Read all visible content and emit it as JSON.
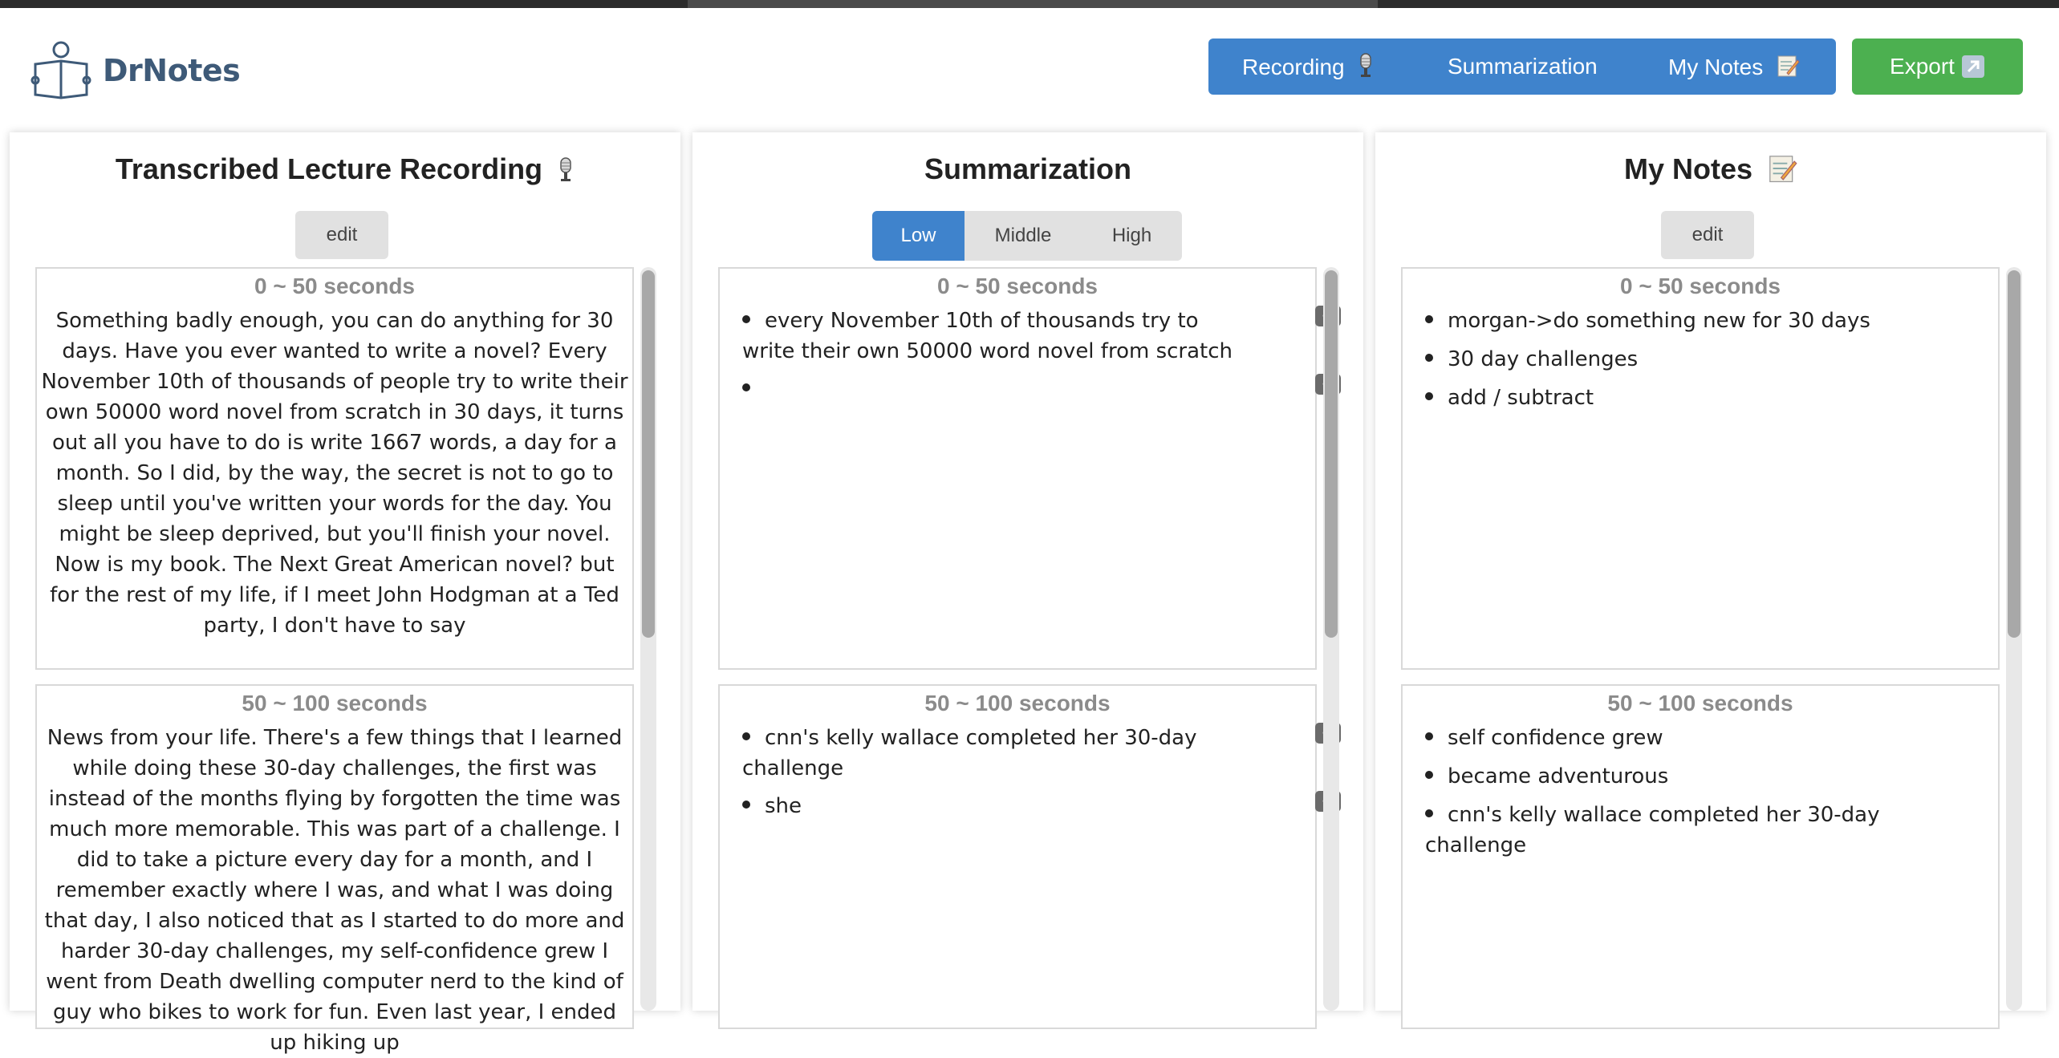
{
  "app": {
    "name": "DrNotes"
  },
  "nav": {
    "recording_label": "Recording",
    "summarization_label": "Summarization",
    "my_notes_label": "My Notes",
    "export_label": "Export"
  },
  "icons": {
    "logo": "reader-book-logo-icon",
    "microphone": "microphone-icon",
    "memo": "memo-icon",
    "export": "export-arrow-icon"
  },
  "colors": {
    "nav_bg": "#3f83cc",
    "export_bg": "#4cb050",
    "brand_text": "#3e5a78",
    "time_label": "#8b8b8b"
  },
  "panels": {
    "transcript": {
      "title": "Transcribed Lecture Recording",
      "edit_label": "edit",
      "chunks": [
        {
          "time": "0 ~ 50 seconds",
          "text": "Something badly enough, you can do anything for 30 days. Have you ever wanted to write a novel? Every November 10th of thousands of people try to write their own 50000 word novel from scratch in 30 days, it turns out all you have to do is write 1667 words, a day for a month. So I did, by the way, the secret is not to go to sleep until you've written your words for the day. You might be sleep deprived, but you'll finish your novel. Now is my book. The Next Great American novel? but for the rest of my life, if I meet John Hodgman at a Ted party, I don't have to say"
        },
        {
          "time": "50 ~ 100 seconds",
          "text": "News from your life. There's a few things that I learned while doing these 30-day challenges, the first was instead of the months flying by forgotten the time was much more memorable. This was part of a challenge. I did to take a picture every day for a month, and I remember exactly where I was, and what I was doing that day, I also noticed that as I started to do more and harder 30-day challenges, my self-confidence grew I went from Death dwelling computer nerd to the kind of guy who bikes to work for fun. Even last year, I ended up hiking up"
        }
      ]
    },
    "summary": {
      "title": "Summarization",
      "levels": [
        "Low",
        "Middle",
        "High"
      ],
      "selected_level": "Low",
      "add_label": "+",
      "chunks": [
        {
          "time": "0 ~ 50 seconds",
          "items": [
            "every November 10th of thousands try to write their own 50000 word novel from scratch",
            ""
          ]
        },
        {
          "time": "50 ~ 100 seconds",
          "items": [
            "cnn's kelly wallace completed her 30-day challenge",
            "she"
          ]
        }
      ]
    },
    "notes": {
      "title": "My Notes",
      "edit_label": "edit",
      "chunks": [
        {
          "time": "0 ~ 50 seconds",
          "items": [
            "morgan->do something new for 30 days",
            "30 day challenges",
            "add / subtract"
          ]
        },
        {
          "time": "50 ~ 100 seconds",
          "items": [
            "self confidence grew",
            "became adventurous",
            "cnn's kelly wallace completed her 30-day challenge"
          ]
        }
      ]
    }
  }
}
